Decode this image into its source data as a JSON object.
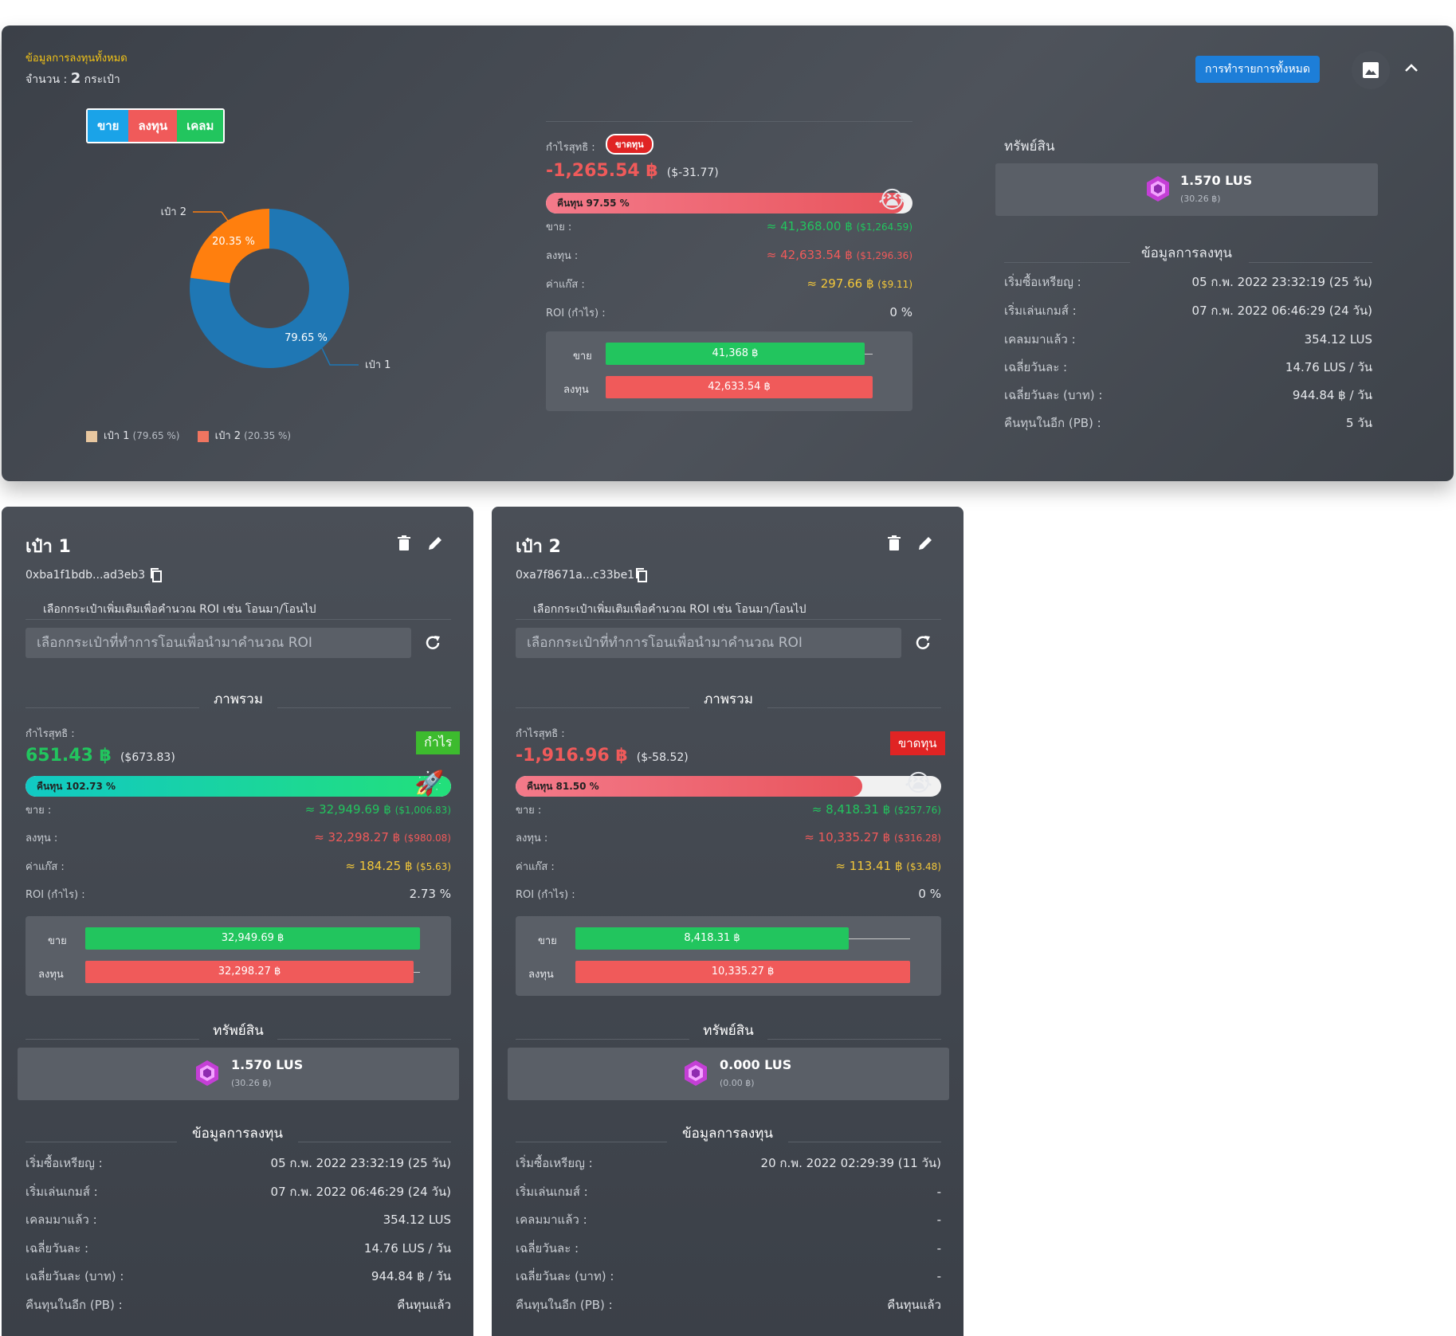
{
  "summary": {
    "title": "ข้อมูลการลงทุนทั้งหมด",
    "count_label": "จำนวน :",
    "count_value": "2",
    "count_unit": "กระเป๋า",
    "tabs": [
      "ขาย",
      "ลงทุน",
      "เคลม"
    ],
    "all_transactions_button": "การทำรายการทั้งหมด",
    "pie": {
      "label_1": "เป๋า 1",
      "label_2": "เป๋า 2",
      "pct_1": "79.65 %",
      "pct_2": "20.35 %"
    },
    "legend": [
      {
        "name": "เป๋า 1",
        "pct": "(79.65 %)"
      },
      {
        "name": "เป๋า 2",
        "pct": "(20.35 %)"
      }
    ],
    "net_profit_label": "กำไรสุทธิ :",
    "status_badge": "ขาดทุน",
    "net_profit_thb": "-1,265.54 ฿",
    "net_profit_usd": "($-31.77)",
    "payback_label": "คืนทุน 97.55 %",
    "rows": [
      {
        "label": "ขาย :",
        "value": "≈ 41,368.00 ฿",
        "usd": "($1,264.59)"
      },
      {
        "label": "ลงทุน :",
        "value": "≈ 42,633.54 ฿",
        "usd": "($1,296.36)"
      },
      {
        "label": "ค่าแก๊ส :",
        "value": "≈ 297.66 ฿",
        "usd": "($9.11)"
      },
      {
        "label": "ROI (กำไร) :",
        "value": "0 %"
      }
    ],
    "bars": {
      "sell_label": "ขาย",
      "sell_value": "41,368 ฿",
      "invest_label": "ลงทุน",
      "invest_value": "42,633.54 ฿"
    },
    "assets_title": "ทรัพย์สิน",
    "asset_amount": "1.570 LUS",
    "asset_thb": "(30.26 ฿)",
    "invest_info_title": "ข้อมูลการลงทุน",
    "info": [
      {
        "label": "เริ่มซื้อเหรียญ :",
        "value": "05 ก.พ. 2022 23:32:19 (25 วัน)"
      },
      {
        "label": "เริ่มเล่นเกมส์ :",
        "value": "07 ก.พ. 2022 06:46:29 (24 วัน)"
      },
      {
        "label": "เคลมมาแล้ว :",
        "value": "354.12 LUS"
      },
      {
        "label": "เฉลี่ยวันละ :",
        "value": "14.76 LUS / วัน"
      },
      {
        "label": "เฉลี่ยวันละ (บาท) :",
        "value": "944.84 ฿ / วัน"
      },
      {
        "label": "คืนทุนในอีก (PB) :",
        "value": "5 วัน"
      }
    ]
  },
  "wallets": [
    {
      "name": "เป๋า 1",
      "address": "0xba1f1bdb...ad3eb3",
      "extra_wallet_hint": "เลือกกระเป๋าเพิ่มเติมเพื่อคำนวณ ROI เช่น โอนมา/โอนไป",
      "select_placeholder": "เลือกกระเป๋าที่ทำการโอนเพื่อนำมาคำนวณ ROI",
      "overview_title": "ภาพรวม",
      "net_profit_label": "กำไรสุทธิ :",
      "tag": "กำไร",
      "net_profit_thb": "651.43 ฿",
      "net_profit_usd": "($673.83)",
      "payback_label": "คืนทุน 102.73 %",
      "payback_fraction": 1.0,
      "rows": [
        {
          "label": "ขาย :",
          "value": "≈ 32,949.69 ฿",
          "usd": "($1,006.83)"
        },
        {
          "label": "ลงทุน :",
          "value": "≈ 32,298.27 ฿",
          "usd": "($980.08)"
        },
        {
          "label": "ค่าแก๊ส :",
          "value": "≈ 184.25 ฿",
          "usd": "($5.63)"
        },
        {
          "label": "ROI (กำไร) :",
          "value": "2.73 %"
        }
      ],
      "bars": {
        "sell_label": "ขาย",
        "sell_value": "32,949.69 ฿",
        "invest_label": "ลงทุน",
        "invest_value": "32,298.27 ฿"
      },
      "assets_title": "ทรัพย์สิน",
      "asset_amount": "1.570 LUS",
      "asset_thb": "(30.26 ฿)",
      "invest_info_title": "ข้อมูลการลงทุน",
      "info": [
        {
          "label": "เริ่มซื้อเหรียญ :",
          "value": "05 ก.พ. 2022 23:32:19 (25 วัน)"
        },
        {
          "label": "เริ่มเล่นเกมส์ :",
          "value": "07 ก.พ. 2022 06:46:29 (24 วัน)"
        },
        {
          "label": "เคลมมาแล้ว :",
          "value": "354.12 LUS"
        },
        {
          "label": "เฉลี่ยวันละ :",
          "value": "14.76 LUS / วัน"
        },
        {
          "label": "เฉลี่ยวันละ (บาท) :",
          "value": "944.84 ฿ / วัน"
        },
        {
          "label": "คืนทุนในอีก (PB) :",
          "value": "คืนทุนแล้ว"
        }
      ]
    },
    {
      "name": "เป๋า 2",
      "address": "0xa7f8671a...c33be1",
      "extra_wallet_hint": "เลือกกระเป๋าเพิ่มเติมเพื่อคำนวณ ROI เช่น โอนมา/โอนไป",
      "select_placeholder": "เลือกกระเป๋าที่ทำการโอนเพื่อนำมาคำนวณ ROI",
      "overview_title": "ภาพรวม",
      "net_profit_label": "กำไรสุทธิ :",
      "tag": "ขาดทุน",
      "net_profit_thb": "-1,916.96 ฿",
      "net_profit_usd": "($-58.52)",
      "payback_label": "คืนทุน 81.50 %",
      "payback_fraction": 0.815,
      "rows": [
        {
          "label": "ขาย :",
          "value": "≈ 8,418.31 ฿",
          "usd": "($257.76)"
        },
        {
          "label": "ลงทุน :",
          "value": "≈ 10,335.27 ฿",
          "usd": "($316.28)"
        },
        {
          "label": "ค่าแก๊ส :",
          "value": "≈ 113.41 ฿",
          "usd": "($3.48)"
        },
        {
          "label": "ROI (กำไร) :",
          "value": "0 %"
        }
      ],
      "bars": {
        "sell_label": "ขาย",
        "sell_value": "8,418.31 ฿",
        "invest_label": "ลงทุน",
        "invest_value": "10,335.27 ฿"
      },
      "assets_title": "ทรัพย์สิน",
      "asset_amount": "0.000 LUS",
      "asset_thb": "(0.00 ฿)",
      "invest_info_title": "ข้อมูลการลงทุน",
      "info": [
        {
          "label": "เริ่มซื้อเหรียญ :",
          "value": "20 ก.พ. 2022 02:29:39 (11 วัน)"
        },
        {
          "label": "เริ่มเล่นเกมส์ :",
          "value": "-"
        },
        {
          "label": "เคลมมาแล้ว :",
          "value": "-"
        },
        {
          "label": "เฉลี่ยวันละ :",
          "value": "-"
        },
        {
          "label": "เฉลี่ยวันละ (บาท) :",
          "value": "-"
        },
        {
          "label": "คืนทุนในอีก (PB) :",
          "value": "คืนทุนแล้ว"
        }
      ]
    }
  ],
  "colors": {
    "green": "#22c55e",
    "red": "#f05a5a",
    "blue": "#1f77b4",
    "orange": "#ff7f0e",
    "accent": "#1d7ed8"
  }
}
